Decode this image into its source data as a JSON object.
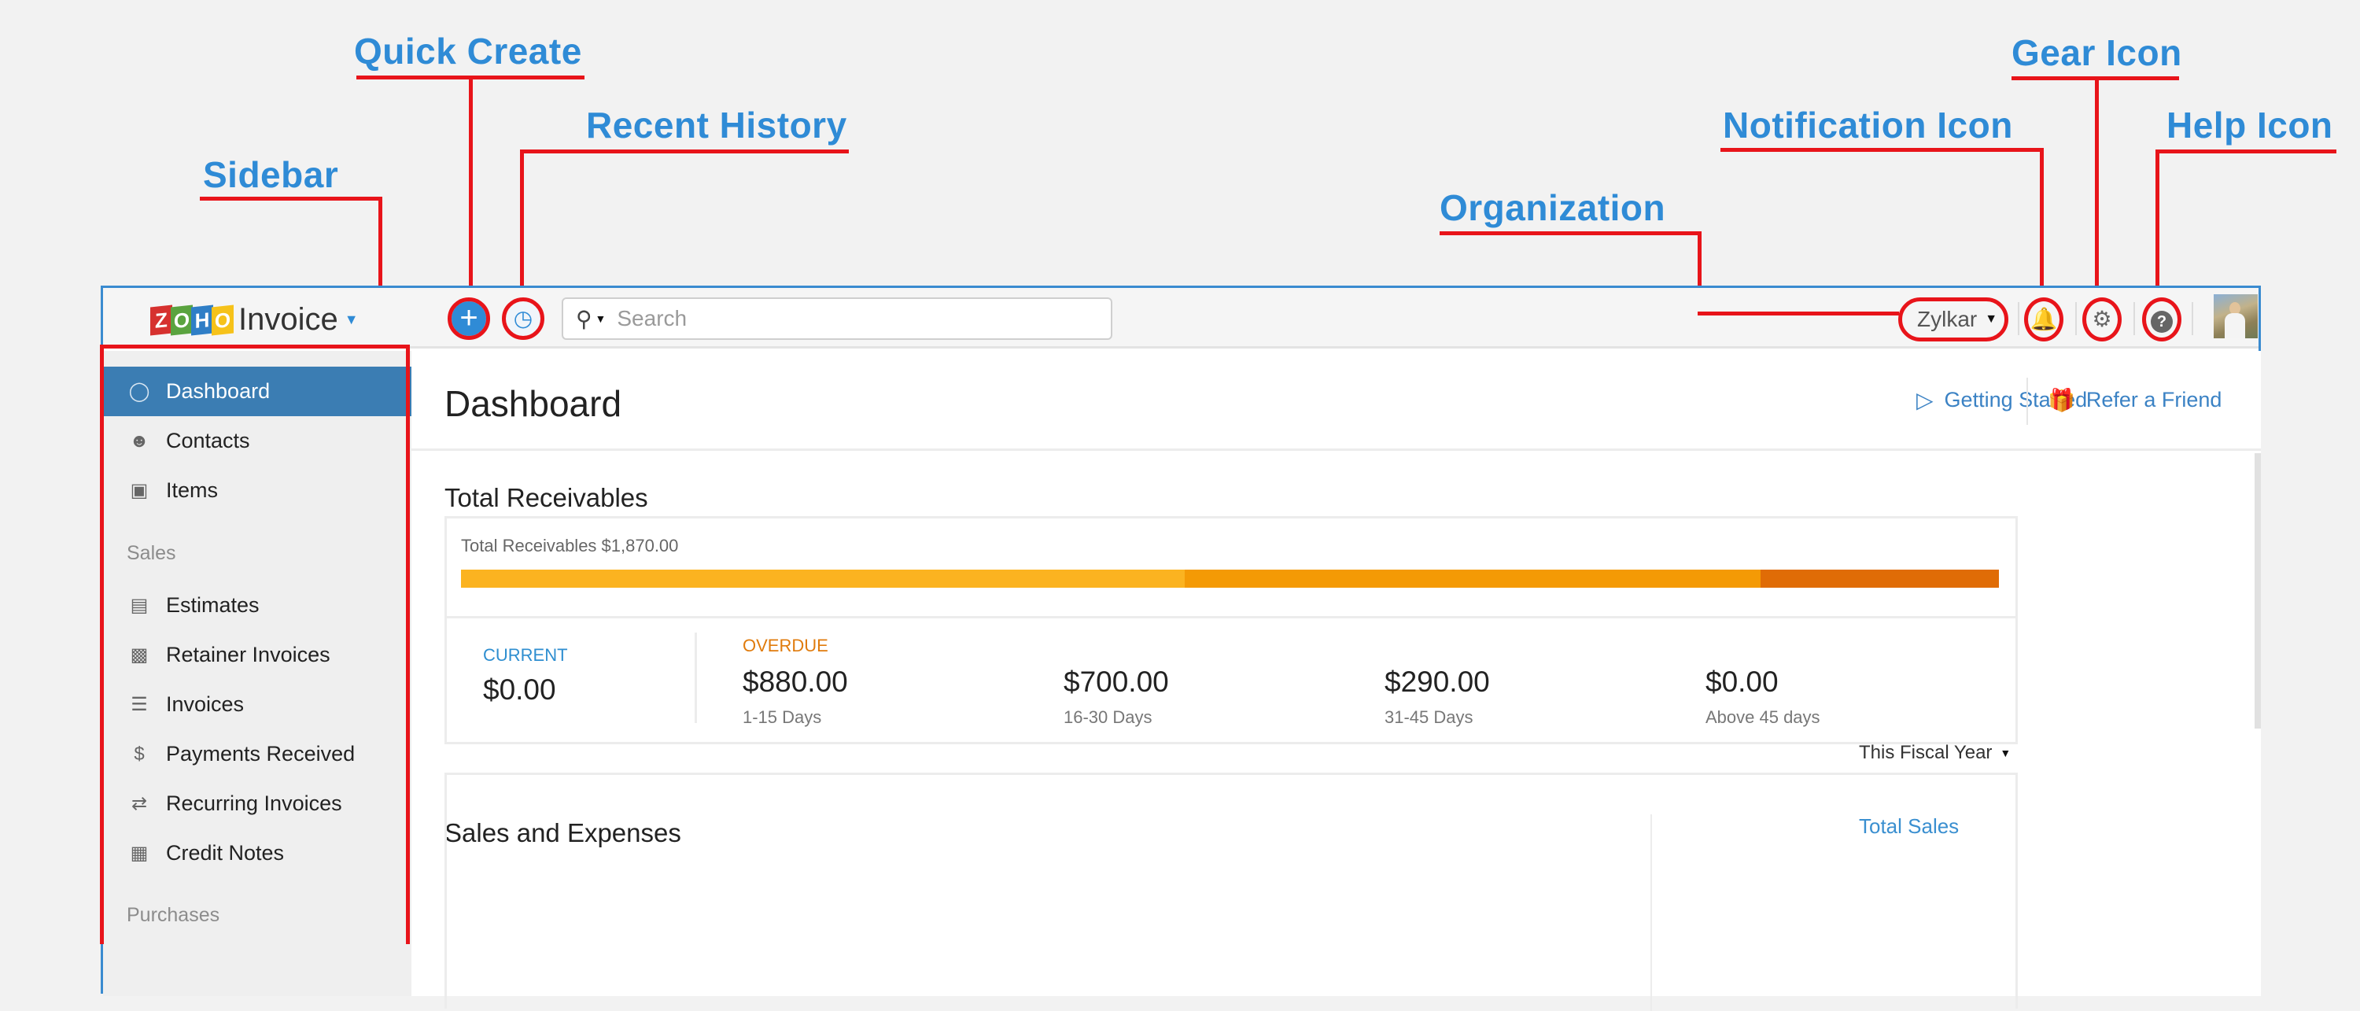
{
  "annotations": {
    "quick_create": "Quick Create",
    "recent_history": "Recent History",
    "sidebar": "Sidebar",
    "organization": "Organization",
    "notification_icon": "Notification Icon",
    "gear_icon": "Gear Icon",
    "help_icon": "Help Icon"
  },
  "header": {
    "logo_letters": [
      "Z",
      "O",
      "H",
      "O"
    ],
    "logo_colors": [
      "#d6312f",
      "#5aa33f",
      "#2f7ec6",
      "#f6c21a"
    ],
    "app_name": "Invoice",
    "quick_create_icon": "plus-icon",
    "recent_history_icon": "history-clock-icon",
    "search_placeholder": "Search",
    "organization": "Zylkar",
    "icons": [
      "bell-icon",
      "gear-icon",
      "help-icon"
    ]
  },
  "sidebar": {
    "items": [
      {
        "label": "Dashboard",
        "icon": "dashboard-icon",
        "active": true
      },
      {
        "label": "Contacts",
        "icon": "contacts-icon"
      },
      {
        "label": "Items",
        "icon": "basket-icon"
      }
    ],
    "sections": [
      {
        "title": "Sales",
        "items": [
          {
            "label": "Estimates",
            "icon": "estimate-icon"
          },
          {
            "label": "Retainer Invoices",
            "icon": "retainer-invoice-icon"
          },
          {
            "label": "Invoices",
            "icon": "invoice-icon"
          },
          {
            "label": "Payments Received",
            "icon": "payment-received-icon"
          },
          {
            "label": "Recurring Invoices",
            "icon": "recurring-invoice-icon"
          },
          {
            "label": "Credit Notes",
            "icon": "credit-note-icon"
          }
        ]
      },
      {
        "title": "Purchases",
        "items": []
      }
    ]
  },
  "main": {
    "title": "Dashboard",
    "links": {
      "getting_started": "Getting Started",
      "refer_friend": "Refer a Friend"
    },
    "receivables": {
      "heading": "Total Receivables",
      "caption": "Total Receivables $1,870.00",
      "total": 1870,
      "segments": [
        {
          "name": "1-15 Days",
          "value": 880,
          "color": "#fbb320"
        },
        {
          "name": "16-30 Days",
          "value": 700,
          "color": "#f49a05"
        },
        {
          "name": "31-45 Days",
          "value": 290,
          "color": "#e06c06"
        }
      ],
      "current": {
        "label": "CURRENT",
        "value": "$0.00",
        "color": "#2e8ed0"
      },
      "overdue_label": "OVERDUE",
      "overdue_color": "#e07b0c",
      "buckets": [
        {
          "value": "$880.00",
          "range": "1-15 Days"
        },
        {
          "value": "$700.00",
          "range": "16-30 Days"
        },
        {
          "value": "$290.00",
          "range": "31-45 Days"
        },
        {
          "value": "$0.00",
          "range": "Above 45 days"
        }
      ]
    },
    "sales_expenses": {
      "heading": "Sales and Expenses",
      "period": "This Fiscal Year",
      "total_sales_label": "Total Sales"
    }
  }
}
